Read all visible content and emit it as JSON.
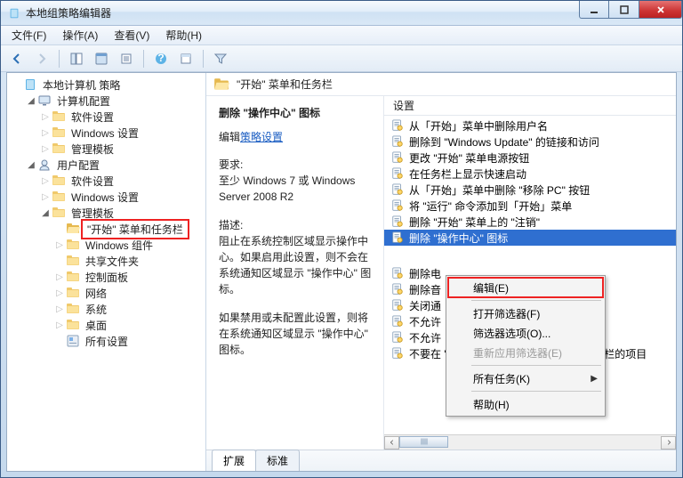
{
  "window": {
    "title": "本地组策略编辑器"
  },
  "menubar": {
    "file": "文件(F)",
    "action": "操作(A)",
    "view": "查看(V)",
    "help": "帮助(H)"
  },
  "tree": {
    "root": "本地计算机 策略",
    "computer_config": "计算机配置",
    "cc_soft": "软件设置",
    "cc_win": "Windows 设置",
    "cc_admin": "管理模板",
    "user_config": "用户配置",
    "uc_soft": "软件设置",
    "uc_win": "Windows 设置",
    "uc_admin": "管理模板",
    "start_taskbar": "\"开始\" 菜单和任务栏",
    "win_comp": "Windows 组件",
    "shared": "共享文件夹",
    "ctrl_panel": "控制面板",
    "network": "网络",
    "system": "系统",
    "desktop": "桌面",
    "all_settings": "所有设置"
  },
  "crumb": {
    "title": "\"开始\" 菜单和任务栏"
  },
  "desc": {
    "selected_title": "删除 \"操作中心\" 图标",
    "edit_label": "编辑",
    "edit_link": "策略设置",
    "req_label": "要求:",
    "req_text": "至少 Windows 7 或 Windows Server 2008 R2",
    "desc_label": "描述:",
    "desc_p1": "阻止在系统控制区域显示操作中心。如果启用此设置，则不会在系统通知区域显示 \"操作中心\" 图标。",
    "desc_p2": "如果禁用或未配置此设置，则将在系统通知区域显示 \"操作中心\" 图标。"
  },
  "list": {
    "header": "设置",
    "items": [
      "从「开始」菜单中删除用户名",
      "删除到 \"Windows Update\" 的链接和访问",
      "更改 \"开始\" 菜单电源按钮",
      "在任务栏上显示快速启动",
      "从「开始」菜单中删除 \"移除 PC\" 按钮",
      "将 \"运行\" 命令添加到「开始」菜单",
      "删除 \"开始\" 菜单上的 \"注销\""
    ],
    "selected": "删除 \"操作中心\" 图标",
    "truncated": [
      "删除电",
      "删除音",
      "关闭通",
      "不允许",
      "不允许",
      "不要在 \"开始\" 菜单中显示任何自定义工具栏的项目"
    ]
  },
  "tabs": {
    "ext": "扩展",
    "std": "标准"
  },
  "ctx": {
    "edit": "编辑(E)",
    "openfilter": "打开筛选器(F)",
    "filteropts": "筛选器选项(O)...",
    "reapply": "重新应用筛选器(E)",
    "alltasks": "所有任务(K)",
    "help": "帮助(H)"
  }
}
